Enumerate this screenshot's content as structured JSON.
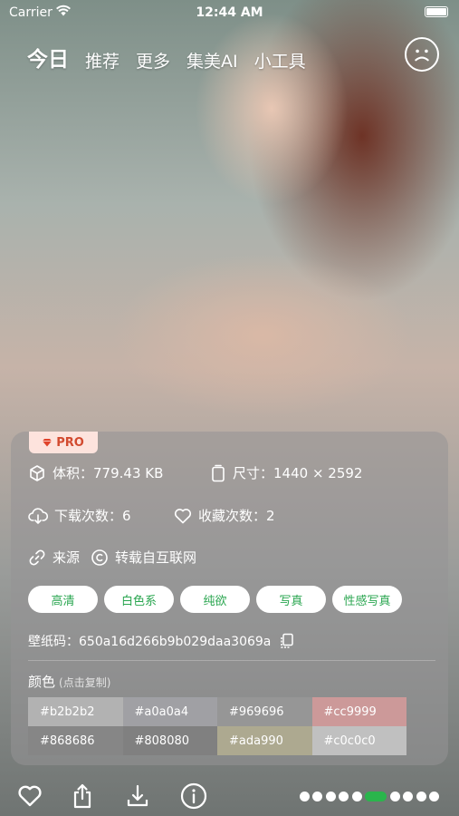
{
  "status": {
    "carrier": "Carrier",
    "time": "12:44 AM"
  },
  "nav": {
    "tabs": [
      "今日",
      "推荐",
      "更多",
      "集美AI",
      "小工具"
    ]
  },
  "panel": {
    "pro": "PRO",
    "size_label": "体积：779.43 KB",
    "dimensions_label": "尺寸：1440 × 2592",
    "downloads_label": "下载次数：6",
    "favorites_label": "收藏次数：2",
    "source_label": "来源",
    "source_value": "转载自互联网",
    "tags": [
      "高清",
      "白色系",
      "纯欲",
      "写真",
      "性感写真"
    ],
    "wallpaper_code": "壁纸码：650a16d266b9b029daa3069a",
    "colors_title": "颜色",
    "colors_hint": "(点击复制)",
    "colors": [
      "#b2b2b2",
      "#a0a0a4",
      "#969696",
      "#cc9999",
      "#868686",
      "#808080",
      "#ada990",
      "#c0c0c0"
    ]
  },
  "bottom": {
    "icons": [
      "heart-icon",
      "share-icon",
      "download-icon",
      "info-icon"
    ],
    "page_dots": 10,
    "active_dot": 5
  }
}
